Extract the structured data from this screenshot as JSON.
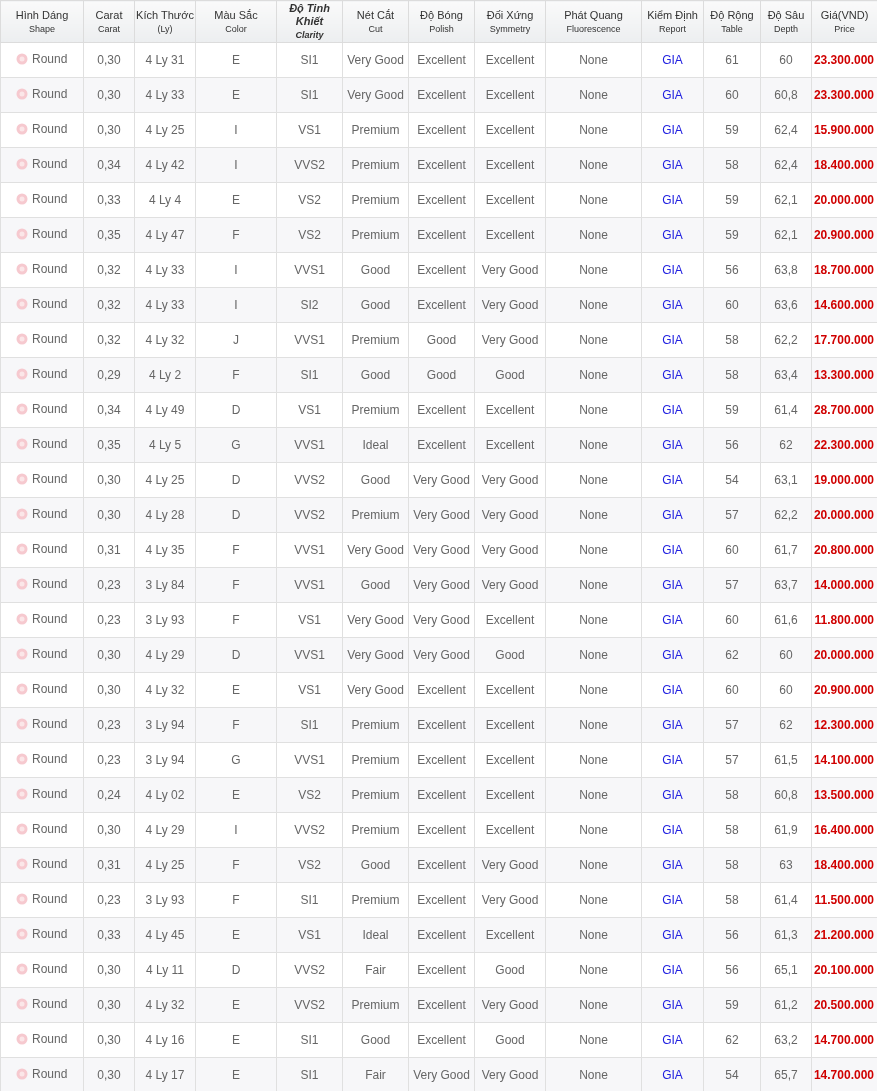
{
  "table": {
    "columns": [
      {
        "title": "Hình Dáng",
        "subtitle": "Shape",
        "kind": "shape"
      },
      {
        "title": "Carat",
        "subtitle": "Carat",
        "kind": "text"
      },
      {
        "title": "Kích Thước",
        "subtitle": "(Ly)",
        "kind": "text"
      },
      {
        "title": "Màu Sắc",
        "subtitle": "Color",
        "kind": "text"
      },
      {
        "title": "Độ Tinh Khiết",
        "subtitle": "Clarity",
        "kind": "text",
        "italic": true
      },
      {
        "title": "Nét Cắt",
        "subtitle": "Cut",
        "kind": "text"
      },
      {
        "title": "Độ Bóng",
        "subtitle": "Polish",
        "kind": "text"
      },
      {
        "title": "Đối Xứng",
        "subtitle": "Symmetry",
        "kind": "text"
      },
      {
        "title": "Phát Quang",
        "subtitle": "Fluorescence",
        "kind": "text"
      },
      {
        "title": "Kiểm Định",
        "subtitle": "Report",
        "kind": "link"
      },
      {
        "title": "Độ Rộng",
        "subtitle": "Table",
        "kind": "text"
      },
      {
        "title": "Độ Sâu",
        "subtitle": "Depth",
        "kind": "text"
      },
      {
        "title": "Giá(VND)",
        "subtitle": "Price",
        "kind": "price"
      }
    ],
    "rows": [
      {
        "cells": [
          "Round",
          "0,30",
          "4 Ly 31",
          "E",
          "SI1",
          "Very Good",
          "Excellent",
          "Excellent",
          "None",
          "GIA",
          "61",
          "60",
          "23.300.000"
        ]
      },
      {
        "cells": [
          "Round",
          "0,30",
          "4 Ly 33",
          "E",
          "SI1",
          "Very Good",
          "Excellent",
          "Excellent",
          "None",
          "GIA",
          "60",
          "60,8",
          "23.300.000"
        ]
      },
      {
        "cells": [
          "Round",
          "0,30",
          "4 Ly 25",
          "I",
          "VS1",
          "Premium",
          "Excellent",
          "Excellent",
          "None",
          "GIA",
          "59",
          "62,4",
          "15.900.000"
        ]
      },
      {
        "cells": [
          "Round",
          "0,34",
          "4 Ly 42",
          "I",
          "VVS2",
          "Premium",
          "Excellent",
          "Excellent",
          "None",
          "GIA",
          "58",
          "62,4",
          "18.400.000"
        ]
      },
      {
        "cells": [
          "Round",
          "0,33",
          "4 Ly 4",
          "E",
          "VS2",
          "Premium",
          "Excellent",
          "Excellent",
          "None",
          "GIA",
          "59",
          "62,1",
          "20.000.000"
        ]
      },
      {
        "cells": [
          "Round",
          "0,35",
          "4 Ly 47",
          "F",
          "VS2",
          "Premium",
          "Excellent",
          "Excellent",
          "None",
          "GIA",
          "59",
          "62,1",
          "20.900.000"
        ]
      },
      {
        "cells": [
          "Round",
          "0,32",
          "4 Ly 33",
          "I",
          "VVS1",
          "Good",
          "Excellent",
          "Very Good",
          "None",
          "GIA",
          "56",
          "63,8",
          "18.700.000"
        ]
      },
      {
        "cells": [
          "Round",
          "0,32",
          "4 Ly 33",
          "I",
          "SI2",
          "Good",
          "Excellent",
          "Very Good",
          "None",
          "GIA",
          "60",
          "63,6",
          "14.600.000"
        ]
      },
      {
        "cells": [
          "Round",
          "0,32",
          "4 Ly 32",
          "J",
          "VVS1",
          "Premium",
          "Good",
          "Very Good",
          "None",
          "GIA",
          "58",
          "62,2",
          "17.700.000"
        ]
      },
      {
        "cells": [
          "Round",
          "0,29",
          "4 Ly 2",
          "F",
          "SI1",
          "Good",
          "Good",
          "Good",
          "None",
          "GIA",
          "58",
          "63,4",
          "13.300.000"
        ]
      },
      {
        "cells": [
          "Round",
          "0,34",
          "4 Ly 49",
          "D",
          "VS1",
          "Premium",
          "Excellent",
          "Excellent",
          "None",
          "GIA",
          "59",
          "61,4",
          "28.700.000"
        ]
      },
      {
        "cells": [
          "Round",
          "0,35",
          "4 Ly 5",
          "G",
          "VVS1",
          "Ideal",
          "Excellent",
          "Excellent",
          "None",
          "GIA",
          "56",
          "62",
          "22.300.000"
        ]
      },
      {
        "cells": [
          "Round",
          "0,30",
          "4 Ly 25",
          "D",
          "VVS2",
          "Good",
          "Very Good",
          "Very Good",
          "None",
          "GIA",
          "54",
          "63,1",
          "19.000.000"
        ]
      },
      {
        "cells": [
          "Round",
          "0,30",
          "4 Ly 28",
          "D",
          "VVS2",
          "Premium",
          "Very Good",
          "Very Good",
          "None",
          "GIA",
          "57",
          "62,2",
          "20.000.000"
        ]
      },
      {
        "cells": [
          "Round",
          "0,31",
          "4 Ly 35",
          "F",
          "VVS1",
          "Very Good",
          "Very Good",
          "Very Good",
          "None",
          "GIA",
          "60",
          "61,7",
          "20.800.000"
        ]
      },
      {
        "cells": [
          "Round",
          "0,23",
          "3 Ly 84",
          "F",
          "VVS1",
          "Good",
          "Very Good",
          "Very Good",
          "None",
          "GIA",
          "57",
          "63,7",
          "14.000.000"
        ]
      },
      {
        "cells": [
          "Round",
          "0,23",
          "3 Ly 93",
          "F",
          "VS1",
          "Very Good",
          "Very Good",
          "Excellent",
          "None",
          "GIA",
          "60",
          "61,6",
          "11.800.000"
        ]
      },
      {
        "cells": [
          "Round",
          "0,30",
          "4 Ly 29",
          "D",
          "VVS1",
          "Very Good",
          "Very Good",
          "Good",
          "None",
          "GIA",
          "62",
          "60",
          "20.000.000"
        ]
      },
      {
        "cells": [
          "Round",
          "0,30",
          "4 Ly 32",
          "E",
          "VS1",
          "Very Good",
          "Excellent",
          "Excellent",
          "None",
          "GIA",
          "60",
          "60",
          "20.900.000"
        ]
      },
      {
        "cells": [
          "Round",
          "0,23",
          "3 Ly 94",
          "F",
          "SI1",
          "Premium",
          "Excellent",
          "Excellent",
          "None",
          "GIA",
          "57",
          "62",
          "12.300.000"
        ]
      },
      {
        "cells": [
          "Round",
          "0,23",
          "3 Ly 94",
          "G",
          "VVS1",
          "Premium",
          "Excellent",
          "Excellent",
          "None",
          "GIA",
          "57",
          "61,5",
          "14.100.000"
        ]
      },
      {
        "cells": [
          "Round",
          "0,24",
          "4 Ly 02",
          "E",
          "VS2",
          "Premium",
          "Excellent",
          "Excellent",
          "None",
          "GIA",
          "58",
          "60,8",
          "13.500.000"
        ]
      },
      {
        "cells": [
          "Round",
          "0,30",
          "4 Ly 29",
          "I",
          "VVS2",
          "Premium",
          "Excellent",
          "Excellent",
          "None",
          "GIA",
          "58",
          "61,9",
          "16.400.000"
        ]
      },
      {
        "cells": [
          "Round",
          "0,31",
          "4 Ly 25",
          "F",
          "VS2",
          "Good",
          "Excellent",
          "Very Good",
          "None",
          "GIA",
          "58",
          "63",
          "18.400.000"
        ]
      },
      {
        "cells": [
          "Round",
          "0,23",
          "3 Ly 93",
          "F",
          "SI1",
          "Premium",
          "Excellent",
          "Very Good",
          "None",
          "GIA",
          "58",
          "61,4",
          "11.500.000"
        ]
      },
      {
        "cells": [
          "Round",
          "0,33",
          "4 Ly 45",
          "E",
          "VS1",
          "Ideal",
          "Excellent",
          "Excellent",
          "None",
          "GIA",
          "56",
          "61,3",
          "21.200.000"
        ]
      },
      {
        "cells": [
          "Round",
          "0,30",
          "4 Ly 11",
          "D",
          "VVS2",
          "Fair",
          "Excellent",
          "Good",
          "None",
          "GIA",
          "56",
          "65,1",
          "20.100.000"
        ]
      },
      {
        "cells": [
          "Round",
          "0,30",
          "4 Ly 32",
          "E",
          "VVS2",
          "Premium",
          "Excellent",
          "Very Good",
          "None",
          "GIA",
          "59",
          "61,2",
          "20.500.000"
        ]
      },
      {
        "cells": [
          "Round",
          "0,30",
          "4 Ly 16",
          "E",
          "SI1",
          "Good",
          "Excellent",
          "Good",
          "None",
          "GIA",
          "62",
          "63,2",
          "14.700.000"
        ]
      },
      {
        "cells": [
          "Round",
          "0,30",
          "4 Ly 17",
          "E",
          "SI1",
          "Fair",
          "Very Good",
          "Very Good",
          "None",
          "GIA",
          "54",
          "65,7",
          "14.700.000"
        ]
      }
    ]
  }
}
